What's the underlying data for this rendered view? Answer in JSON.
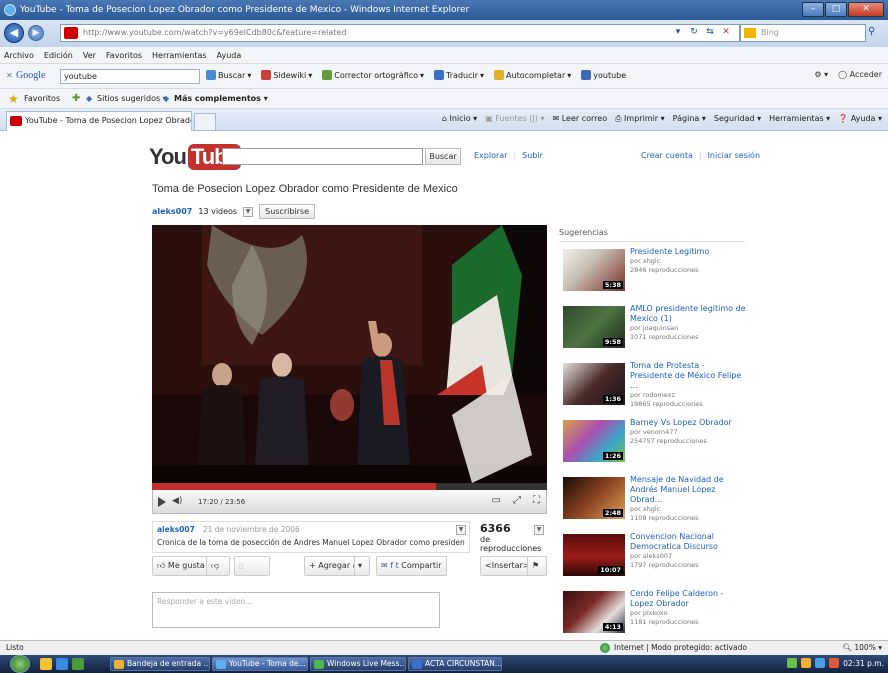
{
  "window": {
    "title": "YouTube - Toma de Posecion Lopez Obrador como Presidente de Mexico - Windows Internet Explorer",
    "btn_min": "–",
    "btn_max": "□",
    "btn_close": "✕"
  },
  "address": {
    "url": "http://www.youtube.com/watch?v=y69elCdb80c&feature=related",
    "search_placeholder": "Bing"
  },
  "menu": [
    "Archivo",
    "Edición",
    "Ver",
    "Favoritos",
    "Herramientas",
    "Ayuda"
  ],
  "google_toolbar": {
    "logo": "Google",
    "query": "youtube",
    "tools": [
      "Buscar",
      "Sidewiki",
      "Corrector ortográfico",
      "Traducir",
      "Autocompletar",
      "youtube"
    ],
    "right": "Acceder"
  },
  "favorites_bar": {
    "favoritos": "Favoritos",
    "sitios": "Sitios sugeridos",
    "mas": "Más complementos"
  },
  "tabs": {
    "active": "YouTube - Toma de Posecion Lopez Obrador co...",
    "commands": [
      "Inicio",
      "Fuentes (J)",
      "Leer correo",
      "Imprimir",
      "Página",
      "Seguridad",
      "Herramientas",
      "Ayuda"
    ]
  },
  "youtube": {
    "logo_you": "You",
    "logo_tube": "Tube",
    "search_button": "Buscar",
    "nav": [
      "Explorar",
      "Subir"
    ],
    "account": [
      "Crear cuenta",
      "Iniciar sesión"
    ],
    "video_title": "Toma de Posecion Lopez Obrador como Presidente de Mexico",
    "channel": "aleks007",
    "video_count": "13 videos",
    "subscribe": "Suscribirse",
    "time": "17:20 / 23:56",
    "progress": 0.72,
    "uploader": "aleks007",
    "date": "21 de noviembre de 2006",
    "description": "Cronica de la toma de posección de Andres Manuel Lopez Obrador como presidente...",
    "views": "6366",
    "views_label": "de reproducciones",
    "like": "Me gusta",
    "add_to": "Agregar a",
    "share": "Compartir",
    "embed": "<Insertar>",
    "comment_placeholder": "Responder a este video..."
  },
  "suggestions": {
    "title": "Sugerencias",
    "items": [
      {
        "title": "Presidente Legitimo",
        "by": "por xhglc",
        "views": "2846 reproducciones",
        "duration": "5:38"
      },
      {
        "title": "AMLO presidente legitimo de Mexico (1)",
        "by": "por joaquinsan",
        "views": "1071 reproducciones",
        "duration": "9:58"
      },
      {
        "title": "Toma de Protesta - Presidente de México Felipe ...",
        "by": "por rodomexz",
        "views": "19865 reproducciones",
        "duration": "1:36"
      },
      {
        "title": "Barney Vs Lopez Obrador",
        "by": "por venom477",
        "views": "254757 reproducciones",
        "duration": "1:26"
      },
      {
        "title": "Mensaje de Navidad de Andrés Manuel López Obrad...",
        "by": "por xhglc",
        "views": "1108 reproducciones",
        "duration": "2:48"
      },
      {
        "title": "Convencion Nacional Democratica Discurso",
        "by": "por aleks007",
        "views": "1797 reproducciones",
        "duration": "10:07"
      },
      {
        "title": "Cerdo Felipe Calderon - Lopez Obrador",
        "by": "por plxkoxo",
        "views": "1181 reproducciones",
        "duration": "4:13"
      }
    ]
  },
  "status": {
    "left": "Listo",
    "zone": "Internet | Modo protegido: activado",
    "zoom": "100%"
  },
  "taskbar": {
    "buttons": [
      "Bandeja de entrada ...",
      "YouTube - Toma de...",
      "Windows Live Mess...",
      "ACTA CIRCUNSTAN..."
    ],
    "clock": "02:31 p.m."
  }
}
